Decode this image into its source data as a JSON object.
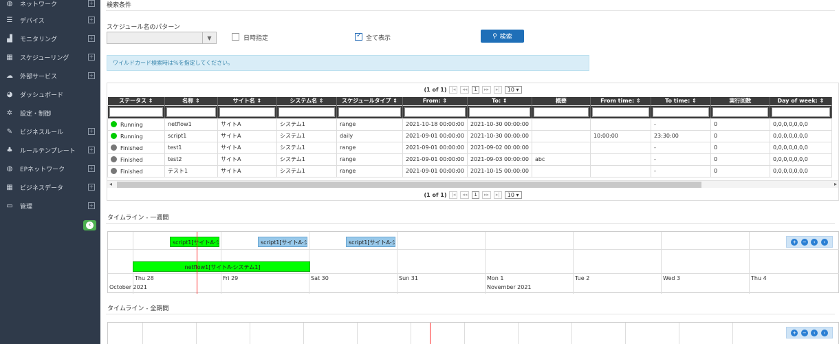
{
  "sidebar": {
    "items": [
      {
        "label": "ネットワーク",
        "icon": "globe-icon",
        "expand": "⊞"
      },
      {
        "label": "デバイス",
        "icon": "server-icon",
        "expand": "⊞"
      },
      {
        "label": "モニタリング",
        "icon": "chart-icon",
        "expand": "⊞"
      },
      {
        "label": "スケジューリング",
        "icon": "calendar-icon",
        "expand": "⊞"
      },
      {
        "label": "外部サービス",
        "icon": "cloud-icon",
        "expand": "⊞"
      },
      {
        "label": "ダッシュボード",
        "icon": "dashboard-icon",
        "expand": ""
      },
      {
        "label": "設定・制御",
        "icon": "gear-icon",
        "expand": ""
      },
      {
        "label": "ビジネスルール",
        "icon": "edit-icon",
        "expand": "⊞"
      },
      {
        "label": "ルールテンプレート",
        "icon": "sitemap-icon",
        "expand": "⊞"
      },
      {
        "label": "EPネットワーク",
        "icon": "globe-icon",
        "expand": "⊞"
      },
      {
        "label": "ビジネスデータ",
        "icon": "table-icon",
        "expand": "⊞"
      },
      {
        "label": "管理",
        "icon": "monitor-icon",
        "expand": "⊞"
      }
    ]
  },
  "search": {
    "title": "検索条件",
    "pattern_label": "スケジュール名のパターン",
    "pattern_value": "",
    "date_label": "日時指定",
    "date_checked": false,
    "show_all_label": "全て表示",
    "show_all_checked": true,
    "button_label": "検索",
    "info": "ワイルドカード検索時は%を指定してください。"
  },
  "table": {
    "pager_text": "(1 of 1)",
    "page": "1",
    "rows_per_page": "10",
    "columns": [
      "ステータス",
      "名称",
      "サイト名",
      "システム名",
      "スケジュールタイプ",
      "From:",
      "To:",
      "概要",
      "From time:",
      "To time:",
      "実行回数",
      "Day of week:"
    ],
    "rows": [
      {
        "status": "Running",
        "status_color": "#00cc00",
        "name": "netflow1",
        "site": "サイトA",
        "system": "システム1",
        "type": "range",
        "from": "2021-10-18 00:00:00",
        "to": "2021-10-30 00:00:00",
        "summary": "",
        "from_time": "",
        "to_time": "-",
        "count": "0",
        "dow": "0,0,0,0,0,0,0"
      },
      {
        "status": "Running",
        "status_color": "#00cc00",
        "name": "script1",
        "site": "サイトA",
        "system": "システム1",
        "type": "daily",
        "from": "2021-09-01 00:00:00",
        "to": "2021-10-30 00:00:00",
        "summary": "",
        "from_time": "10:00:00",
        "to_time": "23:30:00",
        "count": "0",
        "dow": "0,0,0,0,0,0,0"
      },
      {
        "status": "Finished",
        "status_color": "#777777",
        "name": "test1",
        "site": "サイトA",
        "system": "システム1",
        "type": "range",
        "from": "2021-09-01 00:00:00",
        "to": "2021-09-02 00:00:00",
        "summary": "",
        "from_time": "",
        "to_time": "-",
        "count": "0",
        "dow": "0,0,0,0,0,0,0"
      },
      {
        "status": "Finished",
        "status_color": "#777777",
        "name": "test2",
        "site": "サイトA",
        "system": "システム1",
        "type": "range",
        "from": "2021-09-01 00:00:00",
        "to": "2021-09-03 00:00:00",
        "summary": "abc",
        "from_time": "",
        "to_time": "-",
        "count": "0",
        "dow": "0,0,0,0,0,0,0"
      },
      {
        "status": "Finished",
        "status_color": "#777777",
        "name": "テスト1",
        "site": "サイトA",
        "system": "システム1",
        "type": "range",
        "from": "2021-09-01 00:00:00",
        "to": "2021-10-15 00:00:00",
        "summary": "",
        "from_time": "",
        "to_time": "-",
        "count": "0",
        "dow": "0,0,0,0,0,0,0"
      }
    ]
  },
  "timeline_week": {
    "title": "タイムライン - 一週間",
    "days": [
      "Thu 28",
      "Fri 29",
      "Sat 30",
      "Sun 31",
      "Mon 1",
      "Tue 2",
      "Wed 3",
      "Thu 4"
    ],
    "months": [
      "October 2021",
      "November 2021"
    ],
    "bars": [
      {
        "label": "script1[サイトA-シ",
        "color": "green"
      },
      {
        "label": "script1[サイトA-シ",
        "color": "blue"
      },
      {
        "label": "script1[サイトA-シ",
        "color": "blue"
      },
      {
        "label": "netflow1[サイトA-システム1]",
        "color": "green"
      }
    ]
  },
  "timeline_all": {
    "title": "タイムライン - 全期間"
  },
  "colors": {
    "sidebar_bg": "#2f3a4a",
    "primary": "#1f6fb8",
    "running": "#00cc00",
    "finished": "#777777",
    "now_line": "#ff2a2a"
  }
}
